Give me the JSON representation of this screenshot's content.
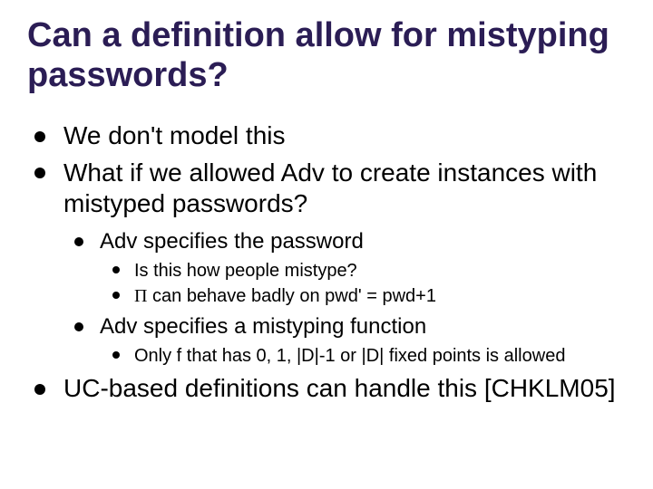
{
  "title": "Can a definition allow for mistyping passwords?",
  "bullets": {
    "b1": "We don't model this",
    "b2": "What if we allowed Adv to create instances with mistyped passwords?",
    "b2_1": "Adv specifies the password",
    "b2_1_1": "Is this how people mistype?",
    "b2_1_2_pre": " ",
    "b2_1_2_pi": "Π",
    "b2_1_2_post": " can behave badly on pwd' = pwd+1",
    "b2_2": "Adv specifies a mistyping function",
    "b2_2_1": "Only f that has 0, 1, |D|-1 or |D| fixed points is allowed",
    "b3": "UC-based definitions can handle this [CHKLM05]"
  }
}
